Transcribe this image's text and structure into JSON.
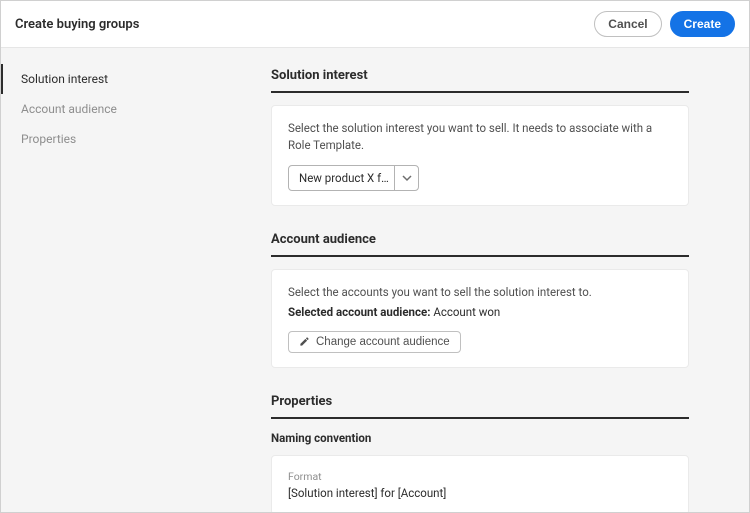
{
  "header": {
    "title": "Create buying groups",
    "cancel_label": "Cancel",
    "create_label": "Create"
  },
  "sidebar": {
    "items": [
      {
        "label": "Solution interest"
      },
      {
        "label": "Account audience"
      },
      {
        "label": "Properties"
      }
    ]
  },
  "sections": {
    "solution_interest": {
      "title": "Solution interest",
      "description": "Select the solution interest you want to sell. It needs to associate with a Role Template.",
      "selected_value": "New product X f…"
    },
    "account_audience": {
      "title": "Account audience",
      "description": "Select the accounts you want to sell the solution interest to.",
      "selected_label": "Selected account audience:",
      "selected_value": "Account won",
      "change_button": "Change account audience"
    },
    "properties": {
      "title": "Properties",
      "naming_heading": "Naming convention",
      "format_label": "Format",
      "format_value": "[Solution interest] for [Account]"
    }
  }
}
